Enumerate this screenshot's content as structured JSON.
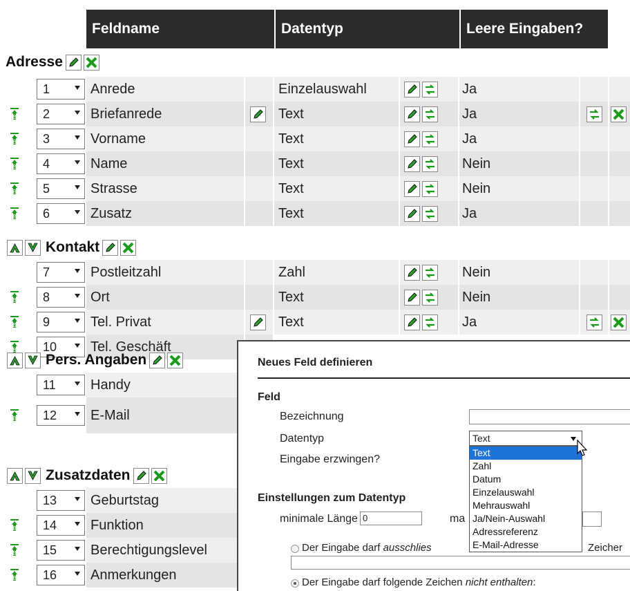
{
  "header": {
    "col_name": "Feldname",
    "col_type": "Datentyp",
    "col_empty": "Leere Eingaben?"
  },
  "groups": [
    {
      "title": "Adresse"
    },
    {
      "title": "Kontakt"
    },
    {
      "title": "Pers. Angaben"
    },
    {
      "title": "Zusatzdaten"
    }
  ],
  "rows": [
    {
      "num": "1",
      "name": "Anrede",
      "type": "Einzelauswahl",
      "empty": "Ja"
    },
    {
      "num": "2",
      "name": "Briefanrede",
      "type": "Text",
      "empty": "Ja"
    },
    {
      "num": "3",
      "name": "Vorname",
      "type": "Text",
      "empty": "Ja"
    },
    {
      "num": "4",
      "name": "Name",
      "type": "Text",
      "empty": "Nein"
    },
    {
      "num": "5",
      "name": "Strasse",
      "type": "Text",
      "empty": "Nein"
    },
    {
      "num": "6",
      "name": "Zusatz",
      "type": "Text",
      "empty": "Ja"
    },
    {
      "num": "7",
      "name": "Postleitzahl",
      "type": "Zahl",
      "empty": "Nein"
    },
    {
      "num": "8",
      "name": "Ort",
      "type": "Text",
      "empty": "Nein"
    },
    {
      "num": "9",
      "name": "Tel. Privat",
      "type": "Text",
      "empty": "Ja"
    },
    {
      "num": "10",
      "name": "Tel. Geschäft"
    },
    {
      "num": "11",
      "name": "Handy"
    },
    {
      "num": "12",
      "name": "E-Mail"
    },
    {
      "num": "13",
      "name": "Geburtstag"
    },
    {
      "num": "14",
      "name": "Funktion"
    },
    {
      "num": "15",
      "name": "Berechtigungslevel"
    },
    {
      "num": "16",
      "name": "Anmerkungen"
    }
  ],
  "dialog": {
    "title": "Neues Feld definieren",
    "section_field": "Feld",
    "label_name": "Bezeichnung",
    "label_type": "Datentyp",
    "label_required": "Eingabe erzwingen?",
    "type_selected": "Text",
    "type_options": [
      "Text",
      "Zahl",
      "Datum",
      "Einzelauswahl",
      "Mehrauswahl",
      "Ja/Nein-Auswahl",
      "Adressreferenz",
      "E-Mail-Adresse"
    ],
    "section_settings": "Einstellungen zum Datentyp",
    "min_length_label": "minimale Länge",
    "min_length_value": "0",
    "max_length_label_fragment": "ma",
    "radio1_prefix": "Der Eingabe darf ",
    "radio1_em": "ausschlies",
    "radio1_suffix": "Zeicher",
    "radio2_prefix": "Der Eingabe darf folgende Zeichen ",
    "radio2_em": "nicht enthalten",
    "radio2_suffix": ":"
  },
  "colors": {
    "header_bg": "#2b2b2b",
    "row_shade": "#e4e4e4",
    "row_plain": "#efefef",
    "icon_green": "#1a9a1a",
    "select_highlight": "#1e73d8"
  },
  "icons": [
    "edit-icon",
    "delete-icon",
    "convert-icon",
    "move-up-icon",
    "move-down-icon",
    "reorder-icon",
    "cursor-icon"
  ]
}
